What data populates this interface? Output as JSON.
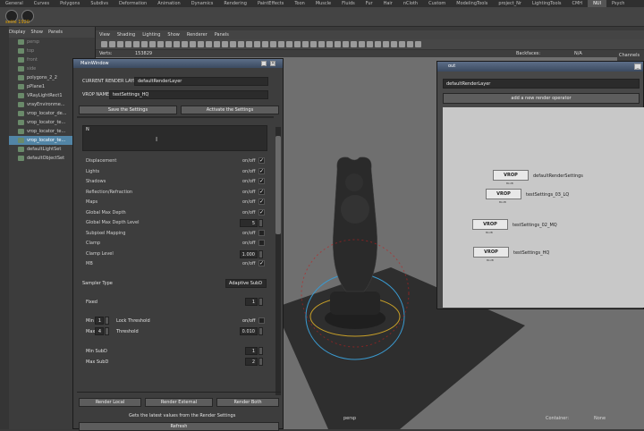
{
  "shelf": {
    "label": "sette 1920",
    "tabs": [
      "General",
      "Curves",
      "Polygons",
      "Subdivs",
      "Deformation",
      "Animation",
      "Dynamics",
      "Rendering",
      "PaintEffects",
      "Toon",
      "Muscle",
      "Fluids",
      "Fur",
      "Hair",
      "nCloth",
      "Custom",
      "ModelingTools",
      "project_Nr",
      "LightingTools",
      "CMH",
      "NUI",
      "Psych"
    ],
    "active_tab": "NUI"
  },
  "outliner": {
    "menu": [
      "Display",
      "Show",
      "Panels"
    ],
    "items": [
      {
        "label": "persp",
        "selected": false,
        "dim": true
      },
      {
        "label": "top",
        "selected": false,
        "dim": true
      },
      {
        "label": "front",
        "selected": false,
        "dim": true
      },
      {
        "label": "side",
        "selected": false,
        "dim": true
      },
      {
        "label": "polygons_2_2",
        "selected": false,
        "dim": false
      },
      {
        "label": "pPlane1",
        "selected": false,
        "dim": false
      },
      {
        "label": "VRayLightRect1",
        "selected": false,
        "dim": false
      },
      {
        "label": "vrayEnvironme...",
        "selected": false,
        "dim": false
      },
      {
        "label": "vrop_locator_de...",
        "selected": false,
        "dim": false
      },
      {
        "label": "vrop_locator_te...",
        "selected": false,
        "dim": false
      },
      {
        "label": "vrop_locator_te...",
        "selected": false,
        "dim": false
      },
      {
        "label": "vrop_locator_te...",
        "selected": true,
        "dim": false
      },
      {
        "label": "defaultLightSet",
        "selected": false,
        "dim": false
      },
      {
        "label": "defaultObjectSet",
        "selected": false,
        "dim": false
      }
    ]
  },
  "viewport": {
    "menu": [
      "View",
      "Shading",
      "Lighting",
      "Show",
      "Renderer",
      "Panels"
    ],
    "stats_verts_label": "Verts:",
    "stats_verts_value": "153829",
    "stats_backfaces_label": "Backfaces:",
    "stats_backfaces_value": "N/A",
    "channels_label": "Channels",
    "camera_label": "persp",
    "container_label": "Container:",
    "container_value": "None"
  },
  "main_window": {
    "title": "MainWindow",
    "current_render_layer_label": "CURRENT RENDER LAYER",
    "current_render_layer_value": "defaultRenderLayer",
    "vrop_name_label": "VROP NAME",
    "vrop_name_value": "testSettings_HQ",
    "save_button": "Save the Settings",
    "activate_button": "Activate the Settings",
    "notes_value": "N",
    "options": [
      {
        "label": "Displacement",
        "state": "on/off",
        "checked": true
      },
      {
        "label": "Lights",
        "state": "on/off",
        "checked": true
      },
      {
        "label": "Shadows",
        "state": "on/off",
        "checked": true
      },
      {
        "label": "Reflection/Refraction",
        "state": "on/off",
        "checked": true
      },
      {
        "label": "Maps",
        "state": "on/off",
        "checked": true
      },
      {
        "label": "Global Max Depth",
        "state": "on/off",
        "checked": true
      },
      {
        "label": "Global Max Depth Level",
        "value": "5"
      },
      {
        "label": "Subpixel Mapping",
        "state": "on/off",
        "checked": false
      },
      {
        "label": "Clamp",
        "state": "on/off",
        "checked": false
      },
      {
        "label": "Clamp Level",
        "value": "1.000"
      },
      {
        "label": "MB",
        "state": "on/off",
        "checked": true
      }
    ],
    "sampler_type_label": "Sampler Type",
    "sampler_type_value": "Adaptive SubD",
    "fixed_label": "Fixed",
    "fixed_value": "1",
    "min_label": "Min",
    "min_value": "1",
    "lock_threshold_label": "Lock Threshold",
    "lock_threshold_state": "on/off",
    "max_label": "Max",
    "max_value": "4",
    "threshold_label": "Threshold",
    "threshold_value": "0.010",
    "min_subd_label": "Min SubD",
    "min_subd_value": "1",
    "max_subd_label": "Max SubD",
    "max_subd_value": "2",
    "render_local": "Render Local",
    "render_external": "Render External",
    "render_both": "Render Both",
    "latest_values_text": "Gets the latest values from the Render Settings",
    "refresh_button": "Refresh"
  },
  "out_window": {
    "title": "out",
    "layer_value": "defaultRenderLayer",
    "add_operator_button": "add a new render operator",
    "nodes": [
      {
        "button": "VROP",
        "sub": "BLUB",
        "name": "defaultRenderSettings"
      },
      {
        "button": "VROP",
        "sub": "BLUB",
        "name": "testSettings_03_LQ"
      },
      {
        "button": "VROP",
        "sub": "BLUB",
        "name": "testSettings_02_MQ"
      },
      {
        "button": "VROP",
        "sub": "BLUB",
        "name": "testSettings_HQ"
      }
    ]
  },
  "colors": {
    "selection": "#5285a6",
    "title_bar": "#4b5c78",
    "viewport": "#6f6f6f"
  }
}
